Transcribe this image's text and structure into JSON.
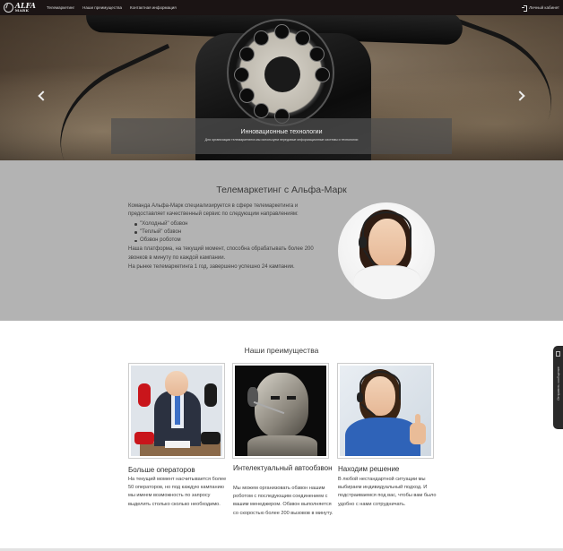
{
  "navbar": {
    "logo_text": "ALFA",
    "logo_sub": "MARK",
    "links": [
      "Телемаркетинг",
      "Наши преимущества",
      "Контактная информация"
    ],
    "account_label": "Личный кабинет"
  },
  "carousel": {
    "caption_title": "Инновационные технологии",
    "caption_text": "Для организации телемаркетинга мы используем передовые информационные системы и технологии",
    "indicator_count": 3,
    "active_indicator": 1
  },
  "about": {
    "title": "Телемаркетинг с Альфа-Марк",
    "intro": "Команда Альфа-Марк специализируется в сфере телемаркетинга и предоставляет качественный сервис по следующим направлениям:",
    "list": [
      "\"Холодный\" обзвон",
      "\"Теплый\" обзвон",
      "Обзвон роботом"
    ],
    "para2": "Наша платформа, на текущий момент, способна обрабатывать более 200 звонков в минуту по каждой кампании.",
    "para3": "На рынке телемаркетинга 1 год, завершено успешно 24 кампании."
  },
  "advantages": {
    "title": "Наши преимущества",
    "cards": [
      {
        "title": "Больше операторов",
        "text": "На текущий момент насчитывается более 50 операторов, но под каждую кампанию мы имеем возможность по запросу выделить столько сколько необходимо."
      },
      {
        "title": "Интелектуальный автообзвон",
        "text": "Мы можем организовать обзвон нашим роботом с последующим соединением с вашим менеджером. Обзвон выполняется со скоростью более 200 вызовов в минуту."
      },
      {
        "title": "Находим решение",
        "text": "В любой нестандартной ситуации мы выбираем индивидуальный подход. И подстраиваемся под вас, чтобы вам было удобно с нами сотрудничать."
      }
    ]
  },
  "side_tab": {
    "label": "Отправить сообщение"
  }
}
